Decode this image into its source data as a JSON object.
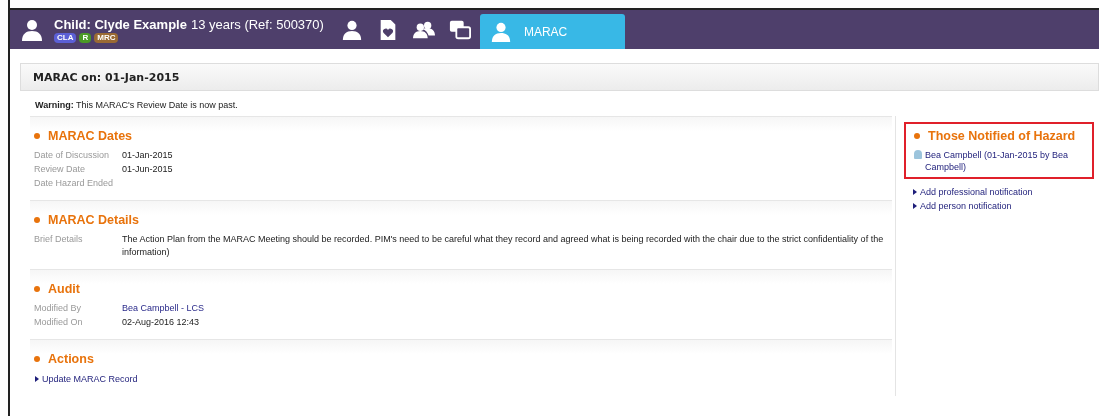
{
  "header": {
    "name": "Child: Clyde Example",
    "details": "13 years (Ref: 500370)",
    "badges": [
      {
        "label": "CLA",
        "color": "#5b5fd6"
      },
      {
        "label": "R",
        "color": "#4b9a26"
      },
      {
        "label": "MRC",
        "color": "#9a6a34"
      }
    ]
  },
  "tabs": [
    {
      "kind": "person",
      "selected": false
    },
    {
      "kind": "document",
      "selected": false
    },
    {
      "kind": "group",
      "selected": false
    },
    {
      "kind": "windows",
      "selected": false
    },
    {
      "kind": "person",
      "label": "MARAC",
      "selected": true
    }
  ],
  "page_title": "MARAC on: 01-Jan-2015",
  "warning": "**Warning:** This MARAC's Review Date is now past.",
  "sections": [
    {
      "title": "MARAC Dates",
      "fields": [
        {
          "label": "Date of Discussion",
          "value": "01-Jan-2015"
        },
        {
          "label": "Review Date",
          "value": "01-Jun-2015"
        },
        {
          "label": "Date Hazard Ended"
        }
      ]
    },
    {
      "title": "MARAC Details",
      "fields": [
        {
          "label": "Brief Details",
          "value": "The Action Plan from the MARAC Meeting should be recorded. PIM's need to be careful what they record and agreed what is being recorded with the chair due to the strict confidentiality of the information)"
        }
      ]
    },
    {
      "title": "Audit",
      "fields": [
        {
          "label": "Modified By",
          "value": "Bea Campbell - LCS",
          "link": true
        },
        {
          "label": "Modified On",
          "value": "02-Aug-2016 12:43"
        }
      ]
    },
    {
      "title": "Actions",
      "links": [
        "Update MARAC Record"
      ]
    }
  ],
  "sidebar": {
    "title": "Those Notified of Hazard",
    "highlighted": true,
    "people": [
      "Bea Campbell (01-Jan-2015 by Bea Campbell)"
    ],
    "links": [
      "Add professional notification",
      "Add person notification"
    ]
  }
}
